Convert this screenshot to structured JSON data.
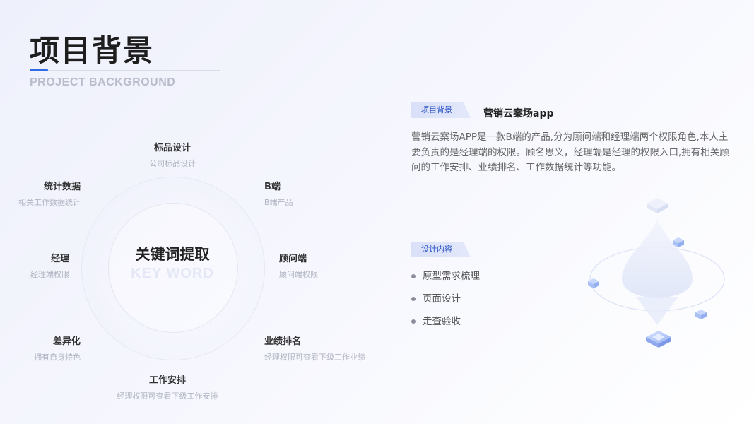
{
  "header": {
    "title": "项目背景",
    "subtitle": "PROJECT BACKGROUND"
  },
  "keyword_diagram": {
    "center_title": "关键词提取",
    "center_subtitle": "KEY WORD",
    "items": [
      {
        "title": "标品设计",
        "sub": "公司标品设计"
      },
      {
        "title": "B端",
        "sub": "B端产品"
      },
      {
        "title": "顾问端",
        "sub": "顾问端权限"
      },
      {
        "title": "业绩排名",
        "sub": "经理权限可查看下级工作业绩"
      },
      {
        "title": "工作安排",
        "sub": "经理权限可查看下级工作安排"
      },
      {
        "title": "差异化",
        "sub": "拥有自身特色"
      },
      {
        "title": "经理",
        "sub": "经理端权限"
      },
      {
        "title": "统计数据",
        "sub": "相关工作数据统计"
      }
    ]
  },
  "background_section": {
    "tag": "项目背景",
    "title": "营销云案场app",
    "paragraph": "营销云案场APP是一款B端的产品,分为顾问端和经理端两个权限角色,本人主要负责的是经理端的权限。顾名思义，经理端是经理的权限入口,拥有相关顾问的工作安排、业绩排名、工作数据统计等功能。"
  },
  "design_section": {
    "tag": "设计内容",
    "items": [
      "原型需求梳理",
      "页面设计",
      "走查验收"
    ]
  },
  "colors": {
    "accent": "#2f6be6",
    "tag_bg": "#d9e0f8",
    "tag_text": "#2f56c6"
  },
  "illustration": {
    "icon": "isometric-cubes-droplet-icon"
  }
}
